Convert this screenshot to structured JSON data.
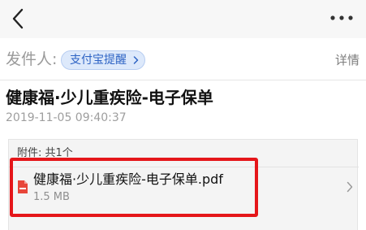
{
  "navbar": {
    "back_icon": "chevron-left-icon",
    "more_icon": "more-horizontal-icon"
  },
  "sender": {
    "label": "发件人:",
    "name": "支付宝提醒",
    "details_label": "详情"
  },
  "message": {
    "subject": "健康福·少儿重疾险-电子保单",
    "timestamp": "2019-11-05 09:40:37"
  },
  "attachments": {
    "header": "附件: 共1个",
    "files": [
      {
        "name": "健康福·少儿重疾险-电子保单.pdf",
        "size": "1.5 MB",
        "icon": "pdf-file-icon"
      }
    ]
  },
  "colors": {
    "accent": "#2d63c4",
    "highlight": "#e5161a",
    "pdf": "#e8463a"
  }
}
